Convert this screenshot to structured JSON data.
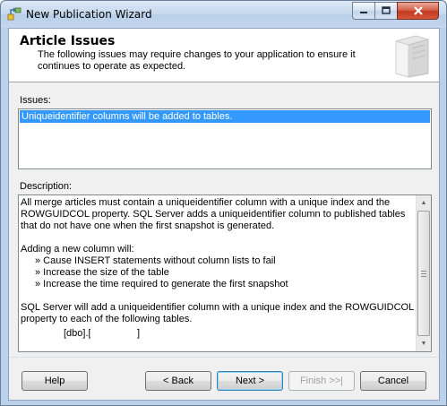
{
  "window": {
    "title": "New Publication Wizard",
    "icon": "publication-wizard-icon"
  },
  "header": {
    "title": "Article Issues",
    "description": "The following issues may require changes to your application to ensure it continues to operate as expected."
  },
  "issues": {
    "label": "Issues:",
    "items": [
      "Uniqueidentifier columns will be added to tables."
    ]
  },
  "description": {
    "label": "Description:",
    "para1": "All merge articles must contain a uniqueidentifier column with a unique index and the ROWGUIDCOL property. SQL Server adds a uniqueidentifier column to published tables that do not have one when the first snapshot is generated.",
    "para2_intro": "Adding a new column will:",
    "bullets": [
      "» Cause INSERT statements without column lists to fail",
      "» Increase the size of the table",
      "» Increase the time required to generate the first snapshot"
    ],
    "para3": "SQL Server will add a uniqueidentifier column with a unique index and the ROWGUIDCOL property to each of the following tables.",
    "table_prefix": "[dbo].[",
    "table_suffix": "]"
  },
  "buttons": {
    "help": "Help",
    "back": "< Back",
    "next": "Next >",
    "finish": "Finish >>|",
    "cancel": "Cancel"
  }
}
